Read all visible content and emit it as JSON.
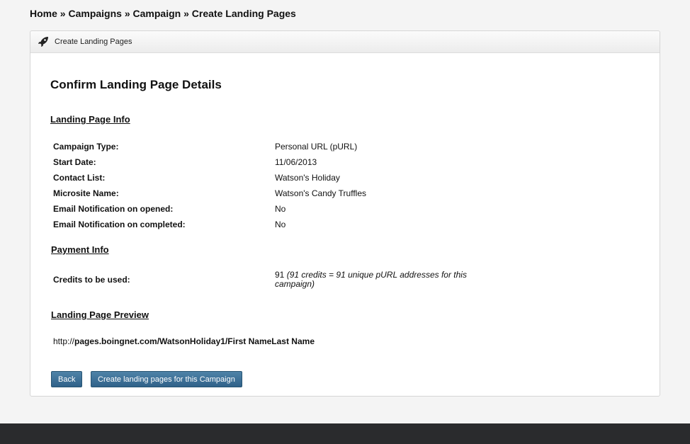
{
  "breadcrumb": {
    "items": [
      "Home",
      "Campaigns",
      "Campaign",
      "Create Landing Pages"
    ],
    "separator": " » "
  },
  "panel": {
    "header_title": "Create Landing Pages",
    "header_icon": "rocket-icon",
    "heading": "Confirm Landing Page Details"
  },
  "landing_info": {
    "title": "Landing Page Info",
    "rows": [
      {
        "label": "Campaign Type:",
        "value": "Personal URL (pURL)"
      },
      {
        "label": "Start Date:",
        "value": "11/06/2013"
      },
      {
        "label": "Contact List:",
        "value": "Watson's Holiday"
      },
      {
        "label": "Microsite Name:",
        "value": "Watson's Candy Truffles"
      },
      {
        "label": "Email Notification on opened:",
        "value": "No"
      },
      {
        "label": "Email Notification on completed:",
        "value": "No"
      }
    ]
  },
  "payment_info": {
    "title": "Payment Info",
    "credits_label": "Credits to be used:",
    "credits_value": "91",
    "credits_note": "(91 credits = 91 unique pURL addresses for this campaign)"
  },
  "preview": {
    "title": "Landing Page Preview",
    "url_prefix": "http://",
    "url_rest": "pages.boingnet.com/WatsonHoliday1/First NameLast Name"
  },
  "buttons": {
    "back": "Back",
    "create": "Create landing pages for this Campaign"
  },
  "colors": {
    "button": "#2f6189",
    "footer": "#2a2b2d",
    "background": "#f4f4f4"
  }
}
